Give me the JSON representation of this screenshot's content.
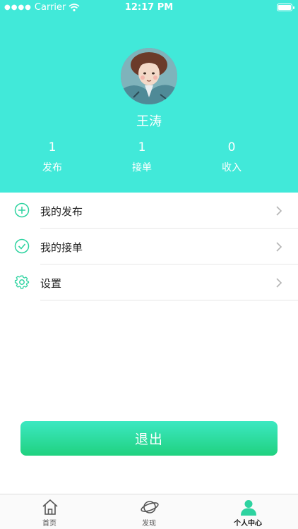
{
  "status_bar": {
    "carrier": "Carrier",
    "time": "12:17 PM"
  },
  "profile": {
    "name": "王涛",
    "stats": [
      {
        "value": "1",
        "label": "发布"
      },
      {
        "value": "1",
        "label": "接单"
      },
      {
        "value": "0",
        "label": "收入"
      }
    ]
  },
  "menu": {
    "items": [
      {
        "label": "我的发布",
        "icon": "plus-circle-icon"
      },
      {
        "label": "我的接单",
        "icon": "check-circle-icon"
      },
      {
        "label": "设置",
        "icon": "gear-icon"
      }
    ]
  },
  "logout": {
    "label": "退出"
  },
  "tabbar": {
    "tabs": [
      {
        "label": "首页",
        "icon": "home-icon"
      },
      {
        "label": "发现",
        "icon": "planet-icon"
      },
      {
        "label": "个人中心",
        "icon": "person-icon"
      }
    ]
  },
  "colors": {
    "header_bg": "#41e9d9",
    "accent": "#2ed3a0",
    "logout_gradient_top": "#3ce8c2",
    "logout_gradient_bottom": "#20d17f"
  }
}
